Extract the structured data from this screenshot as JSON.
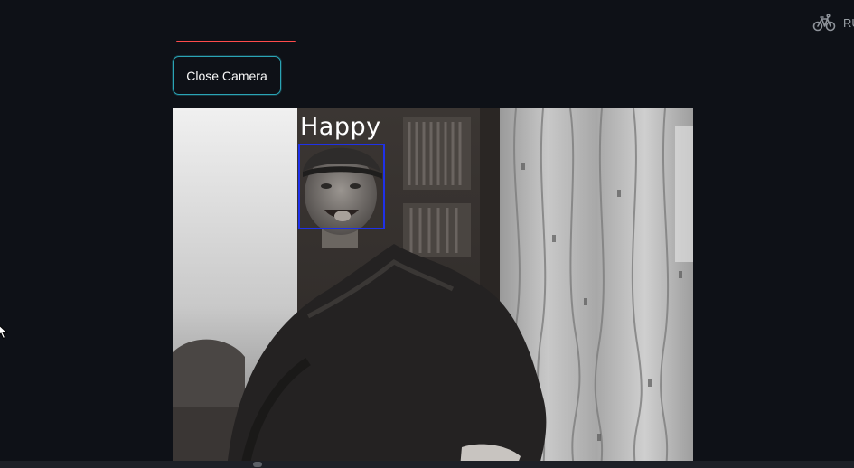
{
  "status": {
    "icon": "bicycle-icon",
    "text": "RUNNING..."
  },
  "progress": {
    "color": "#ff4b4b"
  },
  "controls": {
    "close_camera_label": "Close Camera",
    "border_color": "#2aa4b5"
  },
  "feed": {
    "emotion_label": "Happy",
    "box_color": "#1f31e8"
  },
  "theme": {
    "background": "#0e1117",
    "text": "#fafafa"
  }
}
